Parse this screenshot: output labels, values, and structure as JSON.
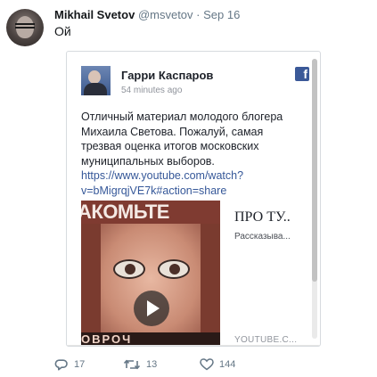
{
  "tweet": {
    "author_name": "Mikhail Svetov",
    "handle": "@msvetov",
    "separator": "·",
    "date": "Sep 16",
    "text": "Ой"
  },
  "embed": {
    "author_name": "Гарри Каспаров",
    "timestamp": "54 minutes ago",
    "logo_letter": "f",
    "body_text": "Отличный материал молодого блогера Михаила Светова. Пожалуй, самая трезвая оценка итогов московских муниципальных выборов.",
    "link": "https://www.youtube.com/watch?v=bMigrqjVE7k#action=share",
    "video": {
      "thumb_top_text": "АКОМЬТЕ",
      "thumb_bottom_text": "ОВРОЧ",
      "title": "ПРО ТУ..",
      "description": "Рассказыва...",
      "domain": "YOUTUBE.C..."
    }
  },
  "actions": {
    "reply_count": "17",
    "retweet_count": "13",
    "like_count": "144"
  },
  "colors": {
    "link": "#365899",
    "facebook": "#3b5998",
    "muted": "#657786"
  }
}
